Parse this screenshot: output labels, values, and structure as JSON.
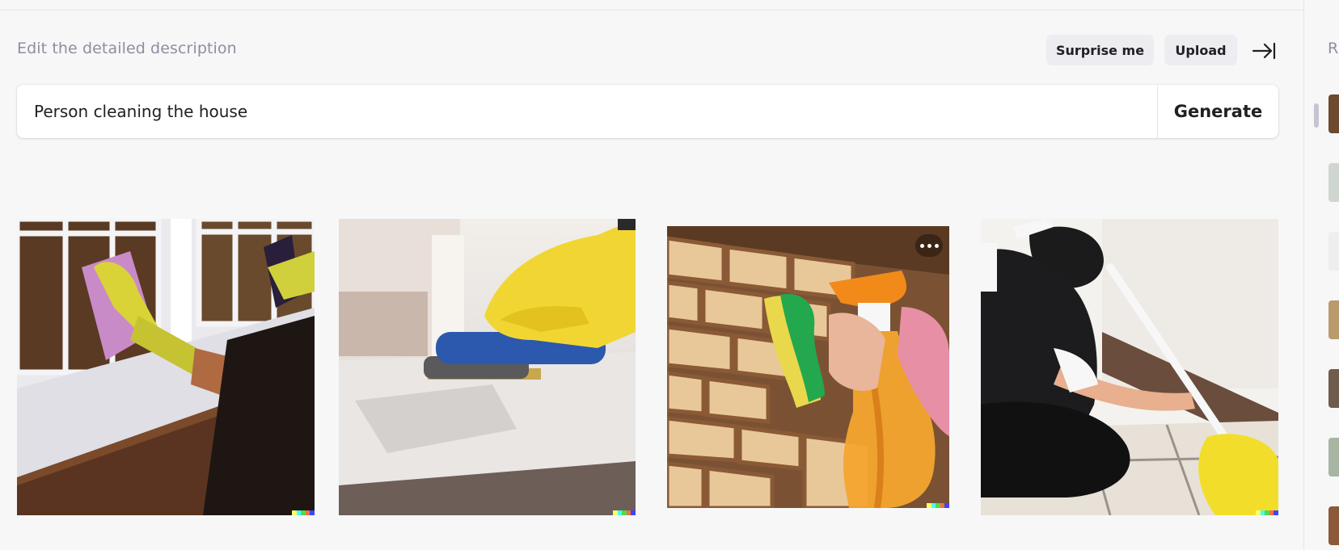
{
  "header": {
    "label": "Edit the detailed description",
    "surprise_label": "Surprise me",
    "upload_label": "Upload",
    "collapse_icon": "arrow-to-right-icon"
  },
  "prompt": {
    "value": "Person cleaning the house",
    "generate_label": "Generate"
  },
  "results": [
    {
      "subject": "gloved-hand-wiping-window",
      "has_watermark": true
    },
    {
      "subject": "gloved-hand-scrubbing-counter",
      "has_watermark": true
    },
    {
      "subject": "spray-bottle-and-sponge-on-brick",
      "has_watermark": true,
      "more_icon": "ellipsis-icon"
    },
    {
      "subject": "person-sweeping-floor",
      "has_watermark": true
    }
  ],
  "watermark_colors": [
    "#ffff66",
    "#42ffff",
    "#51da4c",
    "#ff6e3c",
    "#3c46ff"
  ],
  "sidebar": {
    "title": "R"
  }
}
